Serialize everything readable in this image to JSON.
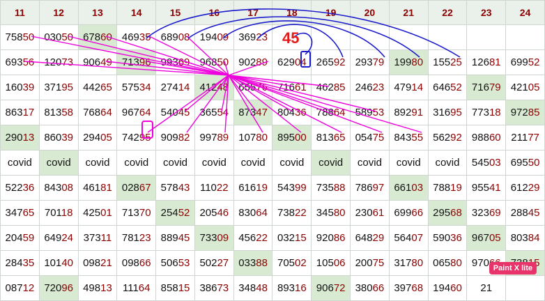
{
  "headers": [
    "11",
    "12",
    "13",
    "14",
    "15",
    "16",
    "17",
    "18",
    "19",
    "20",
    "21",
    "22",
    "23",
    "24"
  ],
  "rows": [
    [
      {
        "v": "75850"
      },
      {
        "v": "03050"
      },
      {
        "v": "67860",
        "hl": true
      },
      {
        "v": "46935"
      },
      {
        "v": "68908"
      },
      {
        "v": "19409"
      },
      {
        "v": "36923"
      },
      {
        "v": ""
      },
      {
        "v": ""
      },
      {
        "v": ""
      },
      {
        "v": ""
      },
      {
        "v": ""
      },
      {
        "v": ""
      },
      {
        "v": ""
      }
    ],
    [
      {
        "v": "69356"
      },
      {
        "v": "12073"
      },
      {
        "v": "90649"
      },
      {
        "v": "71396",
        "hl": true
      },
      {
        "v": "99369"
      },
      {
        "v": "96850"
      },
      {
        "v": "90289"
      },
      {
        "v": "62904"
      },
      {
        "v": "26592"
      },
      {
        "v": "29379"
      },
      {
        "v": "19980",
        "hl": true
      },
      {
        "v": "15525"
      },
      {
        "v": "12681"
      },
      {
        "v": "69952"
      }
    ],
    [
      {
        "v": "16039"
      },
      {
        "v": "37195"
      },
      {
        "v": "44265"
      },
      {
        "v": "57534"
      },
      {
        "v": "27414"
      },
      {
        "v": "41248",
        "hl": true
      },
      {
        "v": "65576"
      },
      {
        "v": "71661"
      },
      {
        "v": "46285"
      },
      {
        "v": "24623"
      },
      {
        "v": "47914"
      },
      {
        "v": "64652"
      },
      {
        "v": "71679",
        "hl": true
      },
      {
        "v": "42105"
      }
    ],
    [
      {
        "v": "86317"
      },
      {
        "v": "81358"
      },
      {
        "v": "76864"
      },
      {
        "v": "96764"
      },
      {
        "v": "54045"
      },
      {
        "v": "36554"
      },
      {
        "v": "87347",
        "hl": true
      },
      {
        "v": "80436"
      },
      {
        "v": "78864"
      },
      {
        "v": "58953"
      },
      {
        "v": "89291"
      },
      {
        "v": "31695"
      },
      {
        "v": "77318"
      },
      {
        "v": "97285",
        "hl": true
      }
    ],
    [
      {
        "v": "29013",
        "hl": true
      },
      {
        "v": "86039"
      },
      {
        "v": "29405"
      },
      {
        "v": "74295"
      },
      {
        "v": "90982"
      },
      {
        "v": "99789"
      },
      {
        "v": "10780"
      },
      {
        "v": "89500",
        "hl": true
      },
      {
        "v": "81365"
      },
      {
        "v": "05475"
      },
      {
        "v": "84355"
      },
      {
        "v": "56292"
      },
      {
        "v": "98860"
      },
      {
        "v": "21177"
      }
    ],
    [
      {
        "v": "covid",
        "c": true
      },
      {
        "v": "covid",
        "c": true,
        "hl": true
      },
      {
        "v": "covid",
        "c": true
      },
      {
        "v": "covid",
        "c": true
      },
      {
        "v": "covid",
        "c": true
      },
      {
        "v": "covid",
        "c": true
      },
      {
        "v": "covid",
        "c": true
      },
      {
        "v": "covid",
        "c": true
      },
      {
        "v": "covid",
        "c": true,
        "hl": true
      },
      {
        "v": "covid",
        "c": true
      },
      {
        "v": "covid",
        "c": true
      },
      {
        "v": "covid",
        "c": true
      },
      {
        "v": "54503"
      },
      {
        "v": "69550"
      }
    ],
    [
      {
        "v": "52236"
      },
      {
        "v": "84308"
      },
      {
        "v": "46181"
      },
      {
        "v": "02867",
        "hl": true
      },
      {
        "v": "57843"
      },
      {
        "v": "11022"
      },
      {
        "v": "61619"
      },
      {
        "v": "54399"
      },
      {
        "v": "73588"
      },
      {
        "v": "78697"
      },
      {
        "v": "66103",
        "hl": true
      },
      {
        "v": "78819"
      },
      {
        "v": "95541"
      },
      {
        "v": "61229"
      }
    ],
    [
      {
        "v": "34765"
      },
      {
        "v": "70118"
      },
      {
        "v": "42501"
      },
      {
        "v": "71370"
      },
      {
        "v": "25452",
        "hl": true
      },
      {
        "v": "20546"
      },
      {
        "v": "83064"
      },
      {
        "v": "73822"
      },
      {
        "v": "34580"
      },
      {
        "v": "23061"
      },
      {
        "v": "69966"
      },
      {
        "v": "29568",
        "hl": true
      },
      {
        "v": "32369"
      },
      {
        "v": "28845"
      }
    ],
    [
      {
        "v": "20459"
      },
      {
        "v": "64924"
      },
      {
        "v": "37311"
      },
      {
        "v": "78123"
      },
      {
        "v": "88945"
      },
      {
        "v": "73309",
        "hl": true
      },
      {
        "v": "45622"
      },
      {
        "v": "03215"
      },
      {
        "v": "92086"
      },
      {
        "v": "64829"
      },
      {
        "v": "56407"
      },
      {
        "v": "59036"
      },
      {
        "v": "96705",
        "hl": true
      },
      {
        "v": "80384"
      }
    ],
    [
      {
        "v": "28435"
      },
      {
        "v": "10140"
      },
      {
        "v": "09821"
      },
      {
        "v": "09866"
      },
      {
        "v": "50653"
      },
      {
        "v": "50227"
      },
      {
        "v": "03388",
        "hl": true
      },
      {
        "v": "70502"
      },
      {
        "v": "10506"
      },
      {
        "v": "20075"
      },
      {
        "v": "31780"
      },
      {
        "v": "06580"
      },
      {
        "v": "97066"
      },
      {
        "v": "73815",
        "hl": true
      }
    ],
    [
      {
        "v": "08712"
      },
      {
        "v": "72096",
        "hl": true
      },
      {
        "v": "49813"
      },
      {
        "v": "11164"
      },
      {
        "v": "85815"
      },
      {
        "v": "38673"
      },
      {
        "v": "34848"
      },
      {
        "v": "89316"
      },
      {
        "v": "90672",
        "hl": true
      },
      {
        "v": "38066"
      },
      {
        "v": "39768"
      },
      {
        "v": "19460"
      },
      {
        "v": "21"
      },
      {
        "v": ""
      }
    ]
  ],
  "annotation": {
    "label": "45",
    "color_magenta": "#ee00dd",
    "color_blue": "#1a1acc",
    "color_red": "#e31b1b"
  },
  "watermark": "Paint X lite"
}
